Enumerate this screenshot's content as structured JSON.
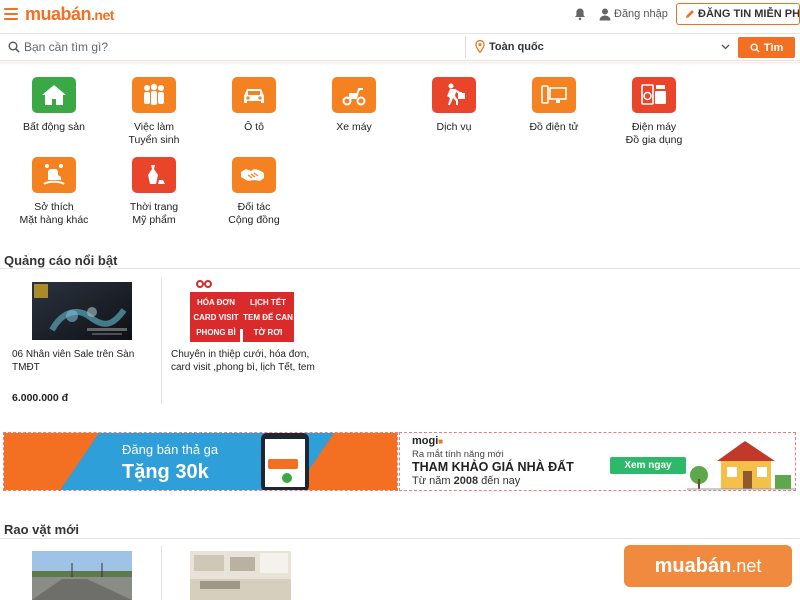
{
  "header": {
    "logo_main": "muabán",
    "logo_tld": ".net",
    "login_label": "Đăng nhập",
    "post_button_label": "ĐĂNG TIN MIỄN PHÍ"
  },
  "search": {
    "placeholder": "Bạn cần tìm gì?",
    "location": "Toàn quốc",
    "button_label": "Tìm"
  },
  "categories": [
    {
      "line1": "Bất động sản",
      "line2": "",
      "icon": "house-icon"
    },
    {
      "line1": "Việc làm",
      "line2": "Tuyển sinh",
      "icon": "people-icon"
    },
    {
      "line1": "Ô tô",
      "line2": "",
      "icon": "car-icon"
    },
    {
      "line1": "Xe máy",
      "line2": "",
      "icon": "scooter-icon"
    },
    {
      "line1": "Dịch vụ",
      "line2": "",
      "icon": "delivery-icon"
    },
    {
      "line1": "Đồ điện tử",
      "line2": "",
      "icon": "electronics-icon"
    },
    {
      "line1": "Điện máy",
      "line2": "Đồ gia dụng",
      "icon": "appliance-icon"
    },
    {
      "line1": "Sở thích",
      "line2": "Mặt hàng khác",
      "icon": "toy-horse-icon"
    },
    {
      "line1": "Thời trang",
      "line2": "Mỹ phẩm",
      "icon": "fashion-icon"
    },
    {
      "line1": "Đối tác",
      "line2": "Cộng đồng",
      "icon": "handshake-icon"
    }
  ],
  "featured": {
    "title": "Quảng cáo nổi bật",
    "ads": [
      {
        "title": "06 Nhân viên Sale trên Sàn TMĐT",
        "price": "6.000.000 đ"
      },
      {
        "title": "Chuyên in thiệp cưới, hóa đơn, card visit ,phong bì, lịch Tết, tem",
        "price": "",
        "img_text": [
          "HÓA ĐƠN",
          "LỊCH TẾT",
          "CARD VISIT",
          "TEM ĐẾ CAN",
          "PHONG BÌ",
          "TỜ RƠI"
        ]
      }
    ]
  },
  "banner_left": {
    "line1": "Đăng bán thả ga",
    "line2": "Tặng 30k"
  },
  "banner_right": {
    "brand": "mogi",
    "line1": "Ra mắt tính năng mới",
    "line2": "THAM KHẢO GIÁ NHÀ ĐẤT",
    "line3_prefix": "Từ năm",
    "line3_year": "2008",
    "line3_suffix": "đến nay",
    "cta": "Xem ngay"
  },
  "new_listings": {
    "title": "Rao vặt mới"
  },
  "watermark": {
    "main": "muabán",
    "tld": ".net"
  },
  "colors": {
    "brand_orange": "#f36f21",
    "icon_orange": "#f58220",
    "green": "#39a845",
    "red": "#e8452b"
  }
}
